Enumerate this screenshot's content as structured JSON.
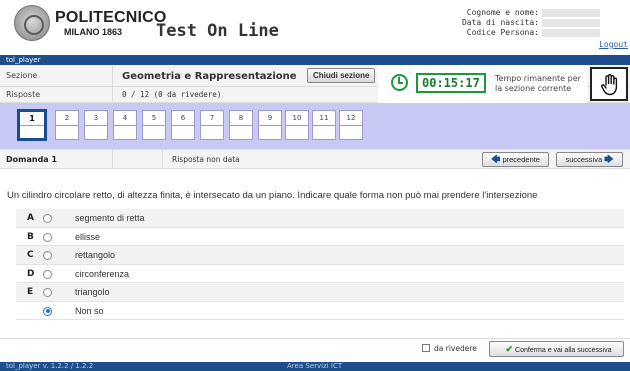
{
  "header": {
    "university_name": "POLITECNICO",
    "university_sub": "MILANO 1863",
    "app_title": "Test On Line",
    "user_fields": [
      "Cognome e nome:",
      "Data di nascita:",
      "Codice Persona:"
    ],
    "logout_label": "Logout"
  },
  "topbar": {
    "label": "tol_player"
  },
  "section": {
    "section_label": "Sezione",
    "section_title": "Geometria e Rappresentazione",
    "close_section_label": "Chiudi sezione",
    "answers_label": "Risposte",
    "answers_value": "0 / 12 (0 da rivedere)",
    "timer_value": "00:15:17",
    "timer_caption_line1": "Tempo rimanente per",
    "timer_caption_line2": "la sezione corrente"
  },
  "question_nav": {
    "numbers": [
      "1",
      "2",
      "3",
      "4",
      "5",
      "6",
      "7",
      "8",
      "9",
      "10",
      "11",
      "12"
    ],
    "active": "1"
  },
  "question": {
    "title": "Domanda 1",
    "status": "Risposta non data",
    "prev_label": "precedente",
    "next_label": "successiva",
    "text": "Un cilindro circolare retto, di altezza finita, è intersecato da un piano. Indicare quale forma non può mai prendere l'intersezione",
    "options": [
      {
        "letter": "A",
        "text": "segmento di retta"
      },
      {
        "letter": "B",
        "text": "ellisse"
      },
      {
        "letter": "C",
        "text": "rettangolo"
      },
      {
        "letter": "D",
        "text": "circonferenza"
      },
      {
        "letter": "E",
        "text": "triangolo"
      },
      {
        "letter": "",
        "text": "Non so"
      }
    ],
    "selected_option": 5
  },
  "bottom": {
    "review_label": "da rivedere",
    "confirm_label": "Conferma e vai alla successiva"
  },
  "footer": {
    "version": "tol_player v. 1.2.2 / 1.2.2",
    "area": "Area Servizi ICT"
  },
  "colors": {
    "brand_blue": "#1e4e8c",
    "timer_green": "#1a9a3a",
    "nav_strip": "#c9c9f5"
  }
}
